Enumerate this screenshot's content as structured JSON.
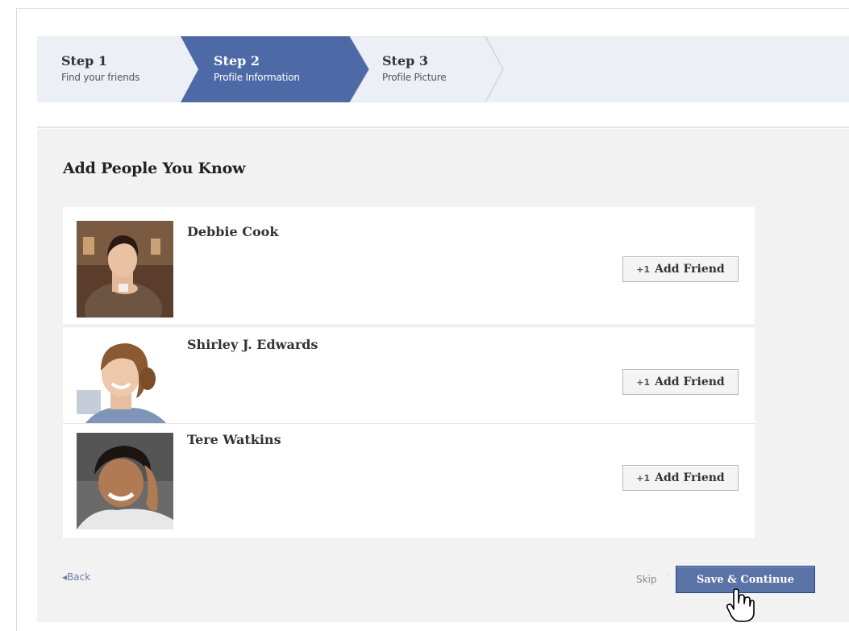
{
  "steps": [
    {
      "title": "Step 1",
      "subtitle": "Find your friends"
    },
    {
      "title": "Step 2",
      "subtitle": "Profile Information"
    },
    {
      "title": "Step 3",
      "subtitle": "Profile Picture"
    }
  ],
  "section_title": "Add People You Know",
  "people": [
    {
      "name": "Debbie Cook",
      "button": "Add Friend"
    },
    {
      "name": "Shirley J. Edwards",
      "button": "Add Friend"
    },
    {
      "name": "Tere Watkins",
      "button": "Add Friend"
    }
  ],
  "footer": {
    "back_label": "Back",
    "skip_label": "Skip",
    "save_label": "Save & Continue"
  },
  "colors": {
    "brand_blue": "#5b74a8",
    "active_step": "#4d6aa6",
    "stepbar_bg": "#eceff5"
  },
  "icons": {
    "add_friend": "add-friend-icon",
    "back": "chevron-left-icon",
    "cursor": "hand-pointer-icon"
  }
}
